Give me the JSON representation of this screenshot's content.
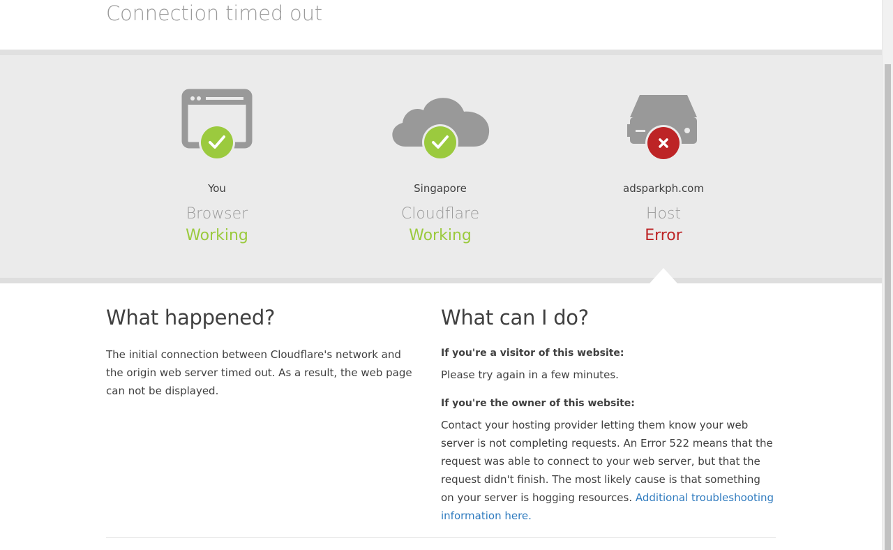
{
  "page": {
    "title": "Connection timed out"
  },
  "status": {
    "columns": [
      {
        "icon": "browser-window-icon",
        "badge": "check",
        "location": "You",
        "name": "Browser",
        "status": "Working",
        "status_color": "#9bca3e"
      },
      {
        "icon": "cloud-icon",
        "badge": "check",
        "location": "Singapore",
        "name": "Cloudflare",
        "status": "Working",
        "status_color": "#9bca3e"
      },
      {
        "icon": "server-icon",
        "badge": "error",
        "location": "adsparkph.com",
        "name": "Host",
        "status": "Error",
        "status_color": "#bd2426"
      }
    ]
  },
  "what_happened": {
    "heading": "What happened?",
    "body": "The initial connection between Cloudflare's network and the origin web server timed out. As a result, the web page can not be displayed."
  },
  "what_can_i_do": {
    "heading": "What can I do?",
    "visitor_heading": "If you're a visitor of this website:",
    "visitor_text": "Please try again in a few minutes.",
    "owner_heading": "If you're the owner of this website:",
    "owner_text": "Contact your hosting provider letting them know your web server is not completing requests. An Error 522 means that the request was able to connect to your web server, but that the request didn't finish. The most likely cause is that something on your server is hogging resources.",
    "owner_link": "Additional troubleshooting information here."
  },
  "colors": {
    "ok": "#9bca3e",
    "error": "#bd2426",
    "icon_gray": "#999999",
    "link": "#2f7bbf"
  }
}
